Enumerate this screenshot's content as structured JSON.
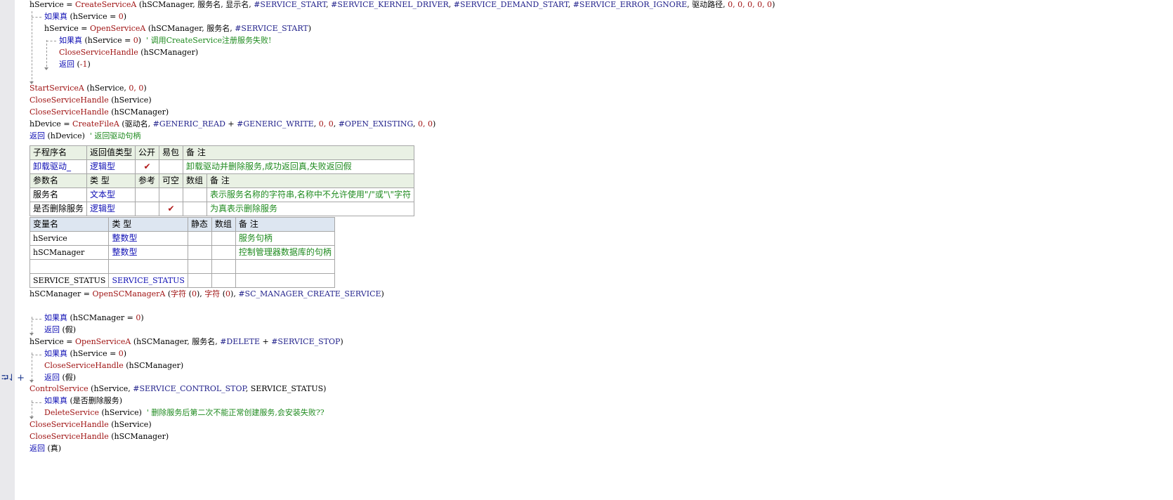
{
  "gutter": {
    "tools": [
      "⮒",
      "⇃",
      "+"
    ]
  },
  "lines": {
    "l1": {
      "var": "hService",
      "op": " = ",
      "fn": "CreateServiceA",
      "args_a": " (hSCManager, 服务名, 显示名, ",
      "c1": "#SERVICE_START",
      "s1": ", ",
      "c2": "#SERVICE_KERNEL_DRIVER",
      "s2": ", ",
      "c3": "#SERVICE_DEMAND_START",
      "s3": ", ",
      "c4": "#SERVICE_ERROR_IGNORE",
      "args_b": ", 驱动路径, ",
      "nums": "0, 0, 0, 0, 0",
      "close": ")"
    },
    "l2": {
      "kw": "如果真",
      "rest_a": " (hService = ",
      "num": "0",
      "rest_b": ")"
    },
    "l3": {
      "var": "hService",
      "op": " = ",
      "fn": "OpenServiceA",
      "args_a": " (hSCManager, 服务名, ",
      "c1": "#SERVICE_START",
      "close": ")"
    },
    "l4": {
      "kw": "如果真",
      "rest_a": " (hService = ",
      "num": "0",
      "rest_b": ")",
      "comment": "  ' 调用CreateService注册服务失败!"
    },
    "l5": {
      "fn": "CloseServiceHandle",
      "args": " (hSCManager)"
    },
    "l6": {
      "kw": "返回",
      "rest": " (",
      "num": "-1",
      "close": ")"
    },
    "l7": {
      "fn": "StartServiceA",
      "args_a": " (hService, ",
      "nums": "0, 0",
      "close": ")"
    },
    "l8": {
      "fn": "CloseServiceHandle",
      "args": " (hService)"
    },
    "l9": {
      "fn": "CloseServiceHandle",
      "args": " (hSCManager)"
    },
    "l10": {
      "var": "hDevice",
      "op": " = ",
      "fn": "CreateFileA",
      "args_a": " (驱动名, ",
      "c1": "#GENERIC_READ",
      "plus": " + ",
      "c2": "#GENERIC_WRITE",
      "s2": ", ",
      "n1": "0, 0",
      "s3": ", ",
      "c3": "#OPEN_EXISTING",
      "s4": ", ",
      "n2": "0, 0",
      "close": ")"
    },
    "l11": {
      "kw": "返回",
      "rest": " (hDevice)",
      "comment": "  ' 返回驱动句柄"
    },
    "l12": {
      "var": "hSCManager",
      "op": " = ",
      "fn": "OpenSCManagerA",
      "args_a": " (",
      "fn2": "字符",
      "a2": " (",
      "n1": "0",
      "a3": "), ",
      "fn3": "字符",
      "a4": " (",
      "n2": "0",
      "a5": "), ",
      "c1": "#SC_MANAGER_CREATE_SERVICE",
      "close": ")"
    },
    "l13": {
      "kw": "如果真",
      "rest_a": " (hSCManager = ",
      "num": "0",
      "rest_b": ")"
    },
    "l14": {
      "kw": "返回",
      "rest": " (假)"
    },
    "l15": {
      "var": "hService",
      "op": " = ",
      "fn": "OpenServiceA",
      "args_a": " (hSCManager, 服务名, ",
      "c1": "#DELETE",
      "plus": " + ",
      "c2": "#SERVICE_STOP",
      "close": ")"
    },
    "l16": {
      "kw": "如果真",
      "rest_a": " (hService = ",
      "num": "0",
      "rest_b": ")"
    },
    "l17": {
      "fn": "CloseServiceHandle",
      "args": " (hSCManager)"
    },
    "l18": {
      "kw": "返回",
      "rest": " (假)"
    },
    "l19": {
      "fn": "ControlService",
      "args_a": " (hService, ",
      "c1": "#SERVICE_CONTROL_STOP",
      "args_b": ", SERVICE_STATUS)"
    },
    "l20": {
      "kw": "如果真",
      "rest": " (是否删除服务)"
    },
    "l21": {
      "fn": "DeleteService",
      "args": " (hService)",
      "comment": "  ' 删除服务后第二次不能正常创建服务,会安装失败??"
    },
    "l22": {
      "fn": "CloseServiceHandle",
      "args": " (hService)"
    },
    "l23": {
      "fn": "CloseServiceHandle",
      "args": " (hSCManager)"
    },
    "l24": {
      "kw": "返回",
      "rest": " (真)"
    }
  },
  "sub_table": {
    "headers": [
      "子程序名",
      "返回值类型",
      "公开",
      "易包",
      "备 注"
    ],
    "row": {
      "name": "卸载驱动_",
      "type": "逻辑型",
      "public": "✔",
      "easy": "",
      "note": "卸载驱动并删除服务,成功返回真,失败返回假"
    },
    "param_headers": [
      "参数名",
      "类 型",
      "参考",
      "可空",
      "数组",
      "备 注"
    ],
    "params": [
      {
        "name": "服务名",
        "type": "文本型",
        "ref": "",
        "nullable": "",
        "array": "",
        "note": "表示服务名称的字符串,名称中不允许使用\"/\"或\"\\\"字符"
      },
      {
        "name": "是否删除服务",
        "type": "逻辑型",
        "ref": "",
        "nullable": "✔",
        "array": "",
        "note": "为真表示删除服务"
      }
    ]
  },
  "var_table": {
    "headers": [
      "变量名",
      "类 型",
      "静态",
      "数组",
      "备 注"
    ],
    "rows": [
      {
        "name": "hService",
        "type": "整数型",
        "static": "",
        "array": "",
        "note": "服务句柄"
      },
      {
        "name": "hSCManager",
        "type": "整数型",
        "static": "",
        "array": "",
        "note": "控制管理器数据库的句柄"
      },
      {
        "name": "",
        "type": "",
        "static": "",
        "array": "",
        "note": ""
      },
      {
        "name": "SERVICE_STATUS",
        "type": "SERVICE_STATUS",
        "static": "",
        "array": "",
        "note": ""
      }
    ]
  }
}
